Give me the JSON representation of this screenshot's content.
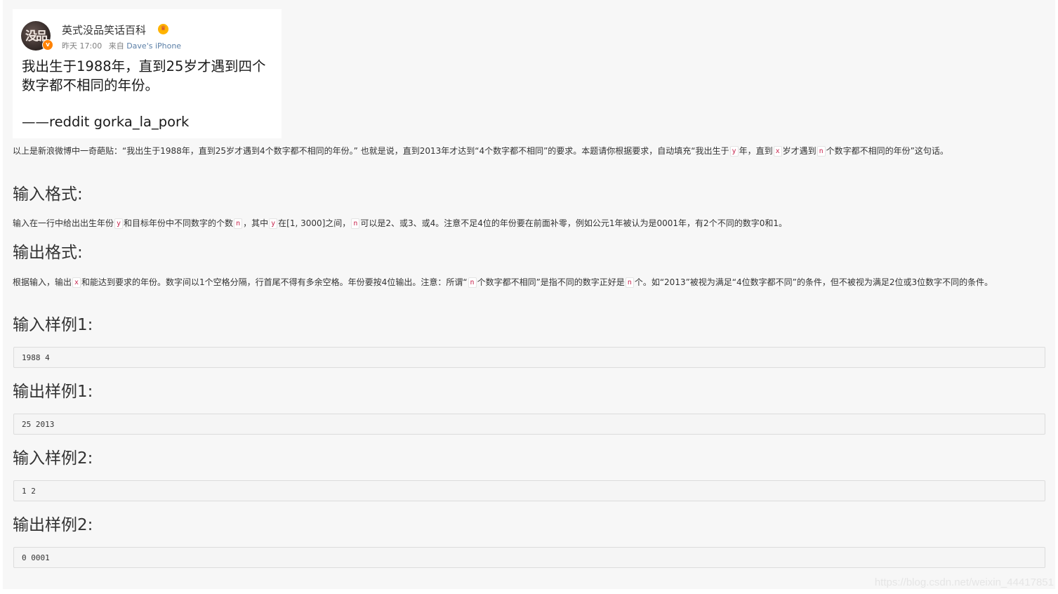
{
  "weibo": {
    "account_name": "英式没品笑话百科",
    "avatar_text": "没品",
    "time": "昨天 17:00",
    "from_label": "来自",
    "device": "Dave's iPhone",
    "post_line1": "我出生于1988年，直到25岁才遇到四个",
    "post_line2": "数字都不相同的年份。",
    "post_source": "——reddit gorka_la_pork"
  },
  "intro": {
    "text1": "以上是新浪微博中一奇葩贴：“我出生于1988年，直到25岁才遇到4个数字都不相同的年份。” 也就是说，直到2013年才达到“4个数字都不相同”的要求。本题请你根据要求，自动填充“我出生于",
    "var_y": "y",
    "text2": "年，直到",
    "var_x": "x",
    "text3": "岁才遇到",
    "var_n": "n",
    "text4": "个数字都不相同的年份”这句话。"
  },
  "input_format": {
    "heading": "输入格式:",
    "text1": "输入在一行中给出出生年份",
    "var_y": "y",
    "text2": "和目标年份中不同数字的个数",
    "var_n": "n",
    "text3": "，其中",
    "var_y2": "y",
    "text4": "在[1, 3000]之间，",
    "var_n2": "n",
    "text5": "可以是2、或3、或4。注意不足4位的年份要在前面补零，例如公元1年被认为是0001年，有2个不同的数字0和1。"
  },
  "output_format": {
    "heading": "输出格式:",
    "text1": "根据输入，输出",
    "var_x": "x",
    "text2": "和能达到要求的年份。数字间以1个空格分隔，行首尾不得有多余空格。年份要按4位输出。注意：所谓“",
    "var_n": "n",
    "text3": "个数字都不相同”是指不同的数字正好是",
    "var_n2": "n",
    "text4": "个。如“2013”被视为满足“4位数字都不同”的条件，但不被视为满足2位或3位数字不同的条件。"
  },
  "samples": [
    {
      "heading": "输入样例1:",
      "code": "1988 4"
    },
    {
      "heading": "输出样例1:",
      "code": "25 2013"
    },
    {
      "heading": "输入样例2:",
      "code": "1 2"
    },
    {
      "heading": "输出样例2:",
      "code": "0 0001"
    }
  ],
  "watermark": "https://blog.csdn.net/weixin_44417851"
}
